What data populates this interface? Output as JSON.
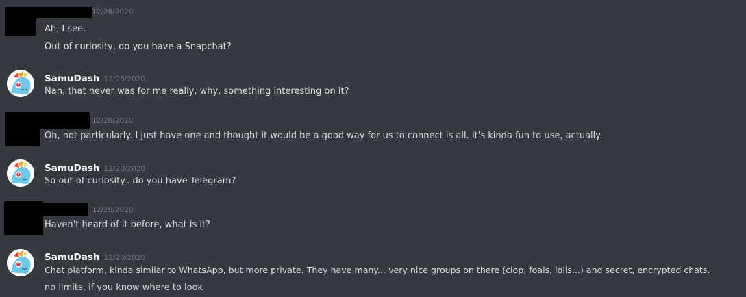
{
  "colors": {
    "background": "#36393f",
    "text": "#dcddde",
    "username": "#ffffff",
    "timestamp": "#72767d",
    "redaction": "#000000"
  },
  "messages": [
    {
      "author": "",
      "author_redacted": true,
      "timestamp": "12/28/2020",
      "lines": [
        "Ah, I see.",
        "Out of curiosity, do you have a Snapchat?"
      ]
    },
    {
      "author": "SamuDash",
      "author_redacted": false,
      "timestamp": "12/28/2020",
      "avatar_icon": "pony-avatar-icon",
      "lines": [
        "Nah, that never was for me really, why, something interesting on it?"
      ]
    },
    {
      "author": "",
      "author_redacted": true,
      "timestamp": "12/28/2020",
      "lines": [
        "Oh, not particularly. I just have one and thought it would be a good way for us to connect is all. It's kinda fun to use, actually."
      ]
    },
    {
      "author": "SamuDash",
      "author_redacted": false,
      "timestamp": "12/28/2020",
      "avatar_icon": "pony-avatar-icon",
      "lines": [
        "So out of curiosity.. do you have Telegram?"
      ]
    },
    {
      "author": "",
      "author_redacted": true,
      "timestamp": "12/28/2020",
      "lines": [
        "Haven't heard of it before, what is it?"
      ]
    },
    {
      "author": "SamuDash",
      "author_redacted": false,
      "timestamp": "12/28/2020",
      "avatar_icon": "pony-avatar-icon",
      "lines": [
        "Chat platform, kinda similar to WhatsApp, but more private. They have many... very nice groups on there (clop, foals, lolis...) and secret, encrypted chats.",
        "no limits, if you know where to look"
      ]
    }
  ]
}
